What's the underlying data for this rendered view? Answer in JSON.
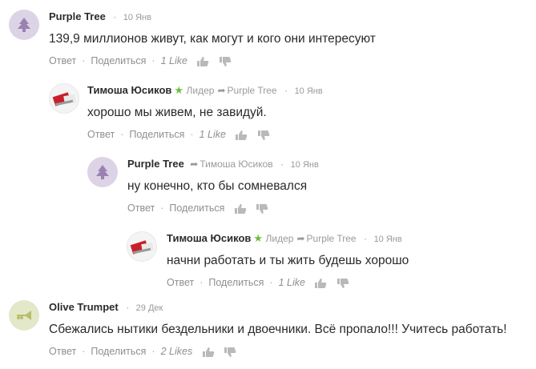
{
  "actions": {
    "reply": "Ответ",
    "share": "Поделиться",
    "separator": "·"
  },
  "colors": {
    "author": "#2b2b2b",
    "meta": "#9a9a9a",
    "star": "#6cbf3a",
    "avatar_purple": "#ddd3e6",
    "avatar_olive": "#e3e8c9"
  },
  "comments": [
    {
      "author": "Purple Tree",
      "date": "10 Янв",
      "text": "139,9 миллионов живут, как могут и кого они интересуют",
      "likes": "1 Like",
      "avatar_icon": "tree-icon"
    },
    {
      "author": "Тимоша Юсиков",
      "role": "Лидер",
      "reply_to": "Purple Tree",
      "date": "10 Янв",
      "text": "хорошо мы живем, не завидуй.",
      "likes": "1 Like",
      "avatar_icon": "photo-avatar"
    },
    {
      "author": "Purple Tree",
      "reply_to": "Тимоша Юсиков",
      "date": "10 Янв",
      "text": "ну конечно, кто бы сомневался",
      "likes": "",
      "avatar_icon": "tree-icon"
    },
    {
      "author": "Тимоша Юсиков",
      "role": "Лидер",
      "reply_to": "Purple Tree",
      "date": "10 Янв",
      "text": "начни работать и ты жить будешь хорошо",
      "likes": "1 Like",
      "avatar_icon": "photo-avatar"
    },
    {
      "author": "Olive Trumpet",
      "date": "29 Дек",
      "text": "Сбежались нытики бездельники и двоечники.  Всё пропало!!!  Учитесь работать!",
      "likes": "2 Likes",
      "avatar_icon": "trumpet-icon"
    }
  ]
}
